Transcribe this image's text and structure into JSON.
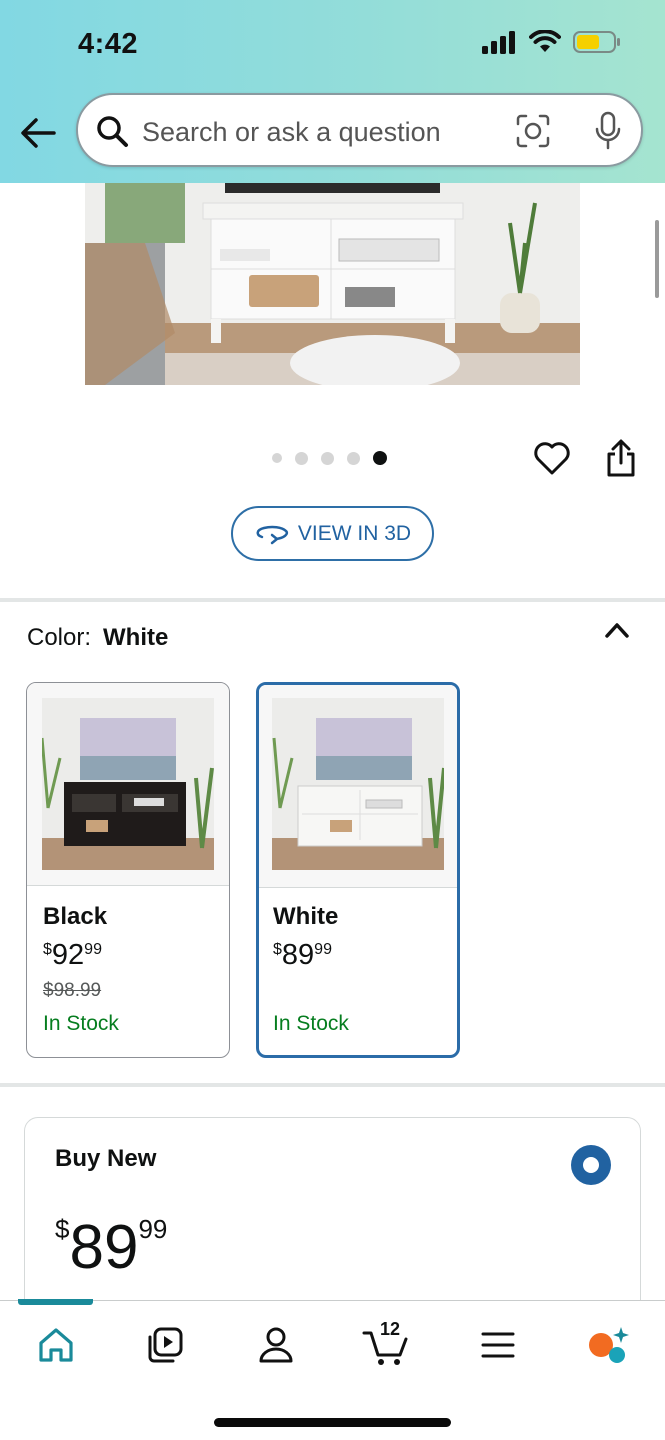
{
  "status_bar": {
    "time": "4:42"
  },
  "search": {
    "placeholder": "Search or ask a question"
  },
  "carousel": {
    "total": 5,
    "active_index": 4
  },
  "view_in_3d": {
    "label": "VIEW IN 3D"
  },
  "color": {
    "label": "Color:",
    "selected": "White"
  },
  "swatches": [
    {
      "name": "Black",
      "price_dollar_sign": "$",
      "price_whole": "92",
      "price_cents": "99",
      "list_price": "$98.99",
      "stock": "In Stock"
    },
    {
      "name": "White",
      "price_dollar_sign": "$",
      "price_whole": "89",
      "price_cents": "99",
      "stock": "In Stock"
    }
  ],
  "buy_new": {
    "title": "Buy New",
    "currency": "$",
    "whole": "89",
    "cents": "99"
  },
  "nav": {
    "cart_count": "12"
  },
  "colors": {
    "accent_blue": "#2162a1",
    "in_stock_green": "#067d1f",
    "nav_teal": "#1a8a9a"
  }
}
